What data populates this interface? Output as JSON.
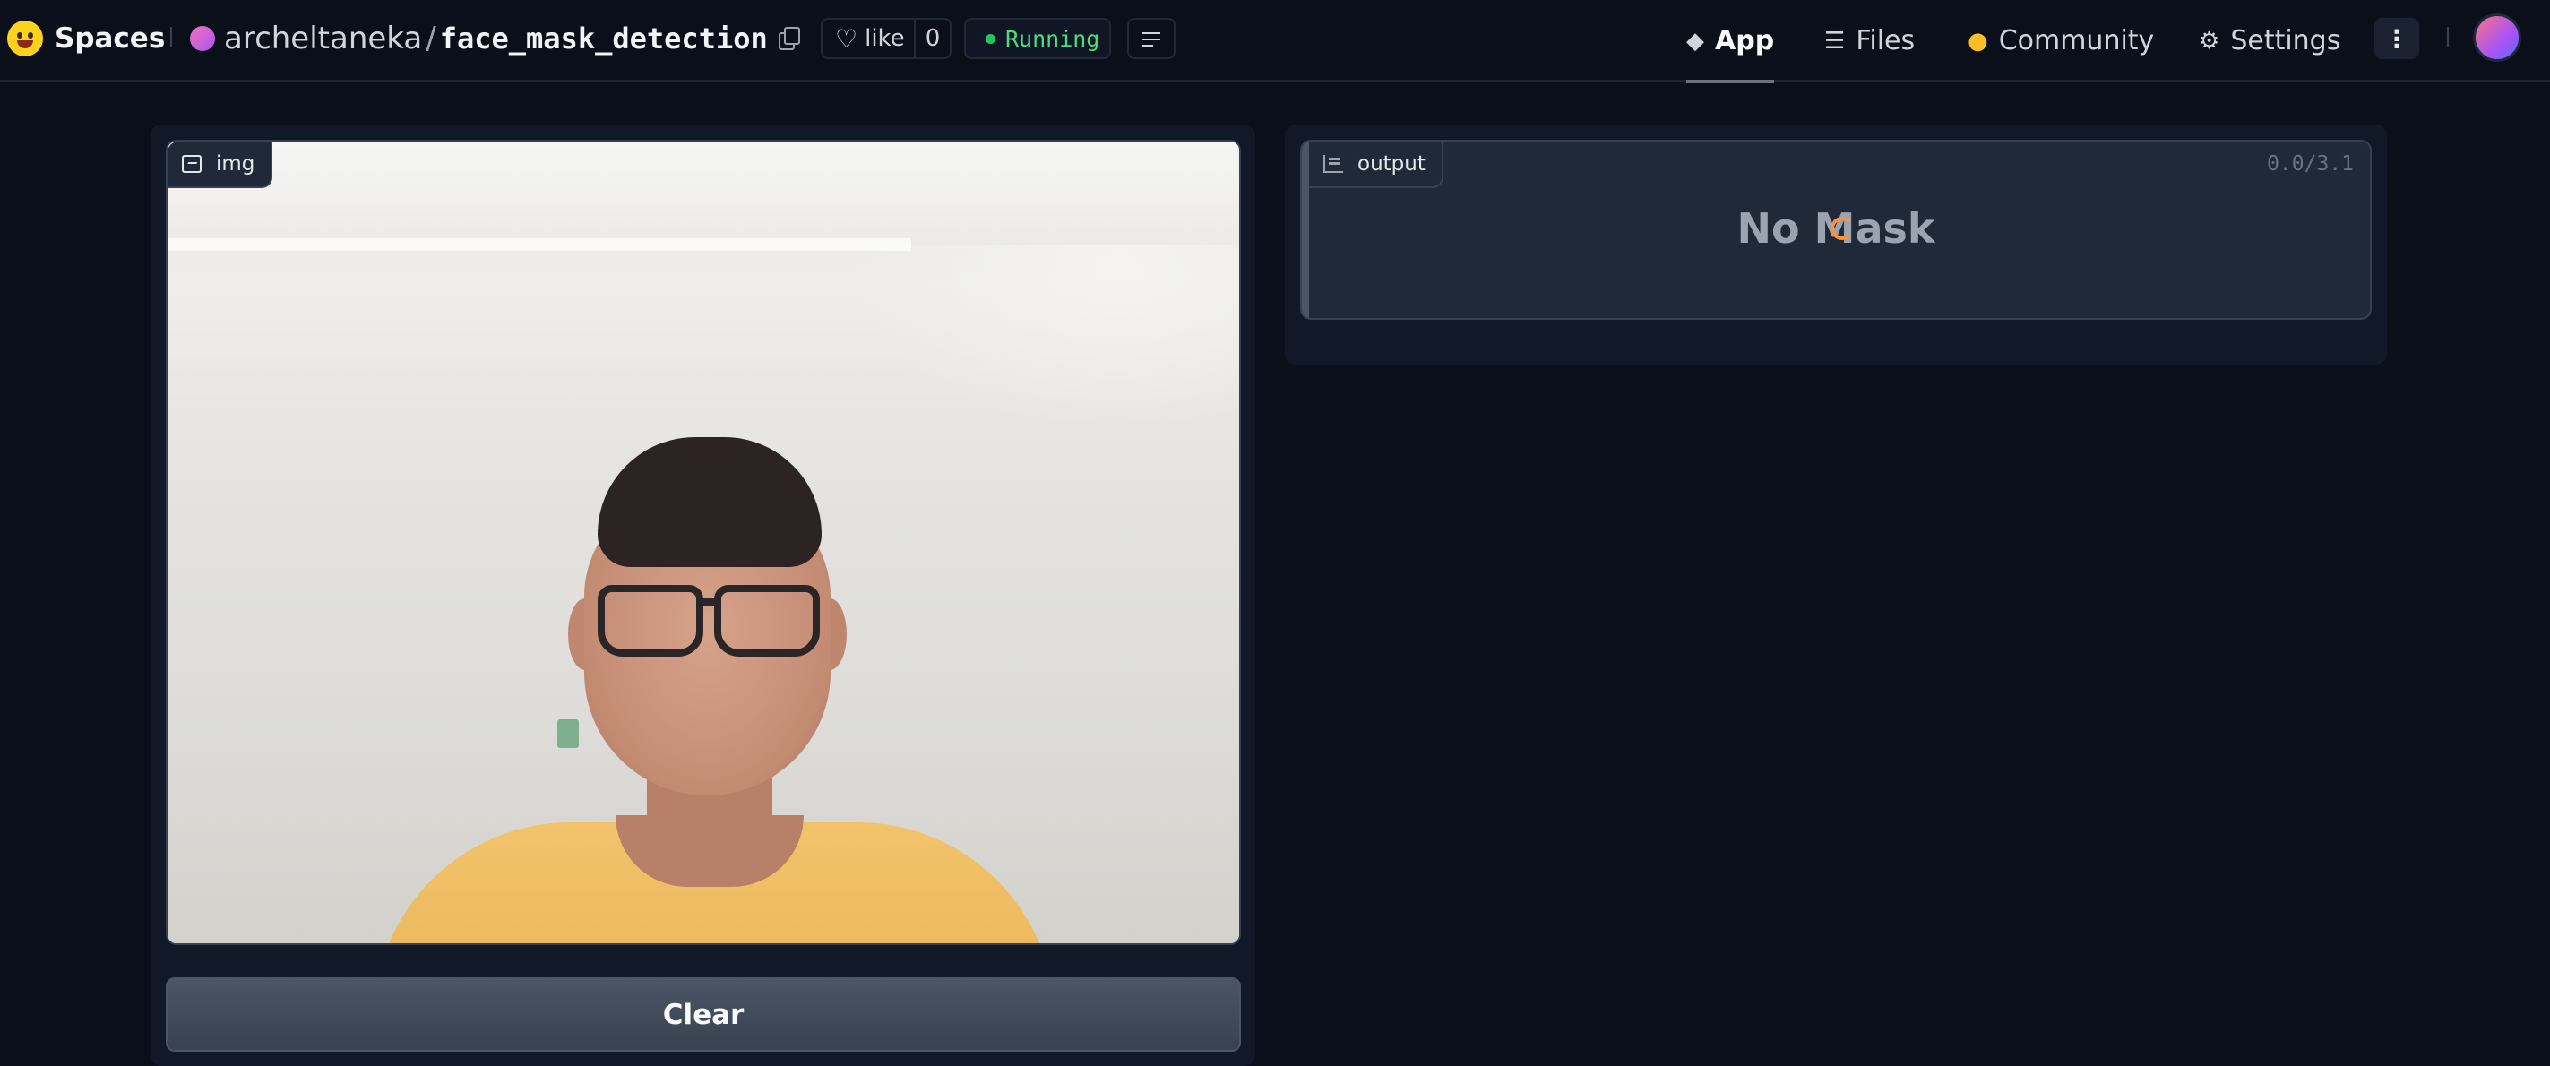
{
  "header": {
    "brand": "Spaces",
    "owner": "archeltaneka",
    "separator": "/",
    "repo_name": "face_mask_detection",
    "like_label": "like",
    "like_count": "0",
    "status": "Running",
    "tabs": [
      {
        "label": "App",
        "icon": "cube-icon"
      },
      {
        "label": "Files",
        "icon": "files-icon"
      },
      {
        "label": "Community",
        "icon": "community-icon"
      },
      {
        "label": "Settings",
        "icon": "gear-icon"
      }
    ]
  },
  "input": {
    "label": "img",
    "clear_label": "Clear"
  },
  "output": {
    "label": "output",
    "timer": "0.0/3.1",
    "result": "No Mask"
  },
  "colors": {
    "background": "#0b0f19",
    "panel": "#111827",
    "status_green": "#4ade80",
    "spinner": "#fb923c"
  }
}
